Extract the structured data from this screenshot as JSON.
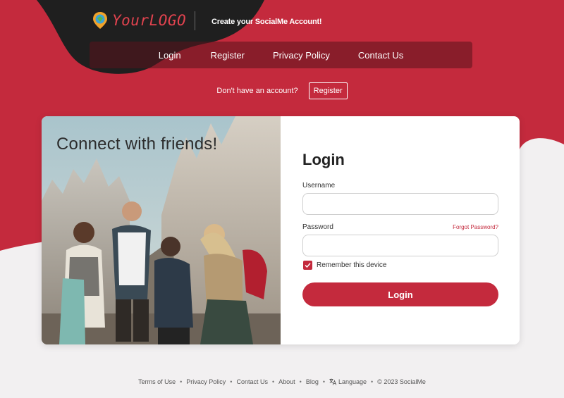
{
  "header": {
    "logo_text": "YourLOGO",
    "tagline": "Create your SocialMe Account!"
  },
  "nav": {
    "items": [
      "Login",
      "Register",
      "Privacy Policy",
      "Contact Us"
    ]
  },
  "signup": {
    "prompt": "Don't have an account?",
    "button": "Register"
  },
  "hero": {
    "headline": "Connect with friends!"
  },
  "login_form": {
    "title": "Login",
    "username_label": "Username",
    "username_value": "",
    "password_label": "Password",
    "password_value": "",
    "forgot_link": "Forgot Password?",
    "remember_label": "Remember this device",
    "remember_checked": true,
    "submit": "Login"
  },
  "footer": {
    "links": [
      "Terms of Use",
      "Privacy Policy",
      "Contact Us",
      "About",
      "Blog"
    ],
    "language": "Language",
    "copyright": "© 2023 SocialMe"
  },
  "colors": {
    "brand_red": "#c42a3d",
    "dark_blob": "#1f1f1f",
    "page_bg": "#f2f0f1"
  },
  "icons": {
    "logo": "map-pin-logo-icon",
    "checkbox": "check-icon",
    "language": "translate-icon"
  }
}
